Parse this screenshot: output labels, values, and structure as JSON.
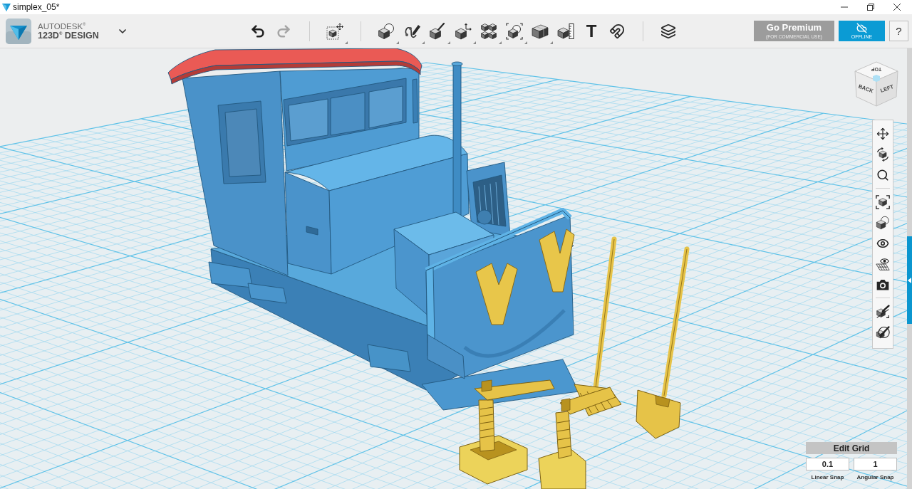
{
  "window": {
    "title": "simplex_05*"
  },
  "brand": {
    "line_1": "AUTODESK$^{®}$",
    "line_2": "123D$^{®}$ DESIGN"
  },
  "toolbar": [
    {
      "kind": "undo",
      "disabled": false,
      "has_menu": false
    },
    {
      "kind": "redo",
      "disabled": true,
      "has_menu": false
    },
    {
      "kind": "separator"
    },
    {
      "kind": "transform",
      "disabled": false,
      "has_menu": true
    },
    {
      "kind": "separator"
    },
    {
      "kind": "primitives",
      "disabled": false,
      "has_menu": true
    },
    {
      "kind": "sketch",
      "disabled": false,
      "has_menu": true
    },
    {
      "kind": "construct",
      "disabled": false,
      "has_menu": true
    },
    {
      "kind": "modify",
      "disabled": false,
      "has_menu": true
    },
    {
      "kind": "pattern",
      "disabled": false,
      "has_menu": true
    },
    {
      "kind": "grouping",
      "disabled": false,
      "has_menu": true
    },
    {
      "kind": "combine",
      "disabled": false,
      "has_menu": true
    },
    {
      "kind": "measure",
      "disabled": false,
      "has_menu": false
    },
    {
      "kind": "text",
      "glyph": "T",
      "disabled": false,
      "has_menu": false
    },
    {
      "kind": "snap",
      "disabled": false,
      "has_menu": false
    },
    {
      "kind": "separator"
    },
    {
      "kind": "materials",
      "disabled": false,
      "has_menu": false
    }
  ],
  "premium_button": {
    "label": "Go Premium",
    "sublabel": "(FOR COMMERCIAL USE)"
  },
  "status_button": {
    "label": "OFFLINE"
  },
  "help_button": {
    "label": "?"
  },
  "view_cube": {
    "top": "TOP",
    "front": "BACK",
    "side": "LEFT"
  },
  "navigation_bar": [
    {
      "kind": "pan"
    },
    {
      "kind": "orbit"
    },
    {
      "kind": "zoom"
    },
    {
      "kind": "separator"
    },
    {
      "kind": "fit"
    },
    {
      "kind": "views"
    },
    {
      "kind": "visibility"
    },
    {
      "kind": "grid_visibility"
    },
    {
      "kind": "camera"
    },
    {
      "kind": "separator"
    },
    {
      "kind": "hide"
    },
    {
      "kind": "show"
    }
  ],
  "edit_grid": {
    "title": "Edit Grid",
    "fields": [
      {
        "value": "0.1",
        "label": "Linear Snap"
      },
      {
        "value": "1",
        "label": "Angular Snap"
      }
    ]
  }
}
